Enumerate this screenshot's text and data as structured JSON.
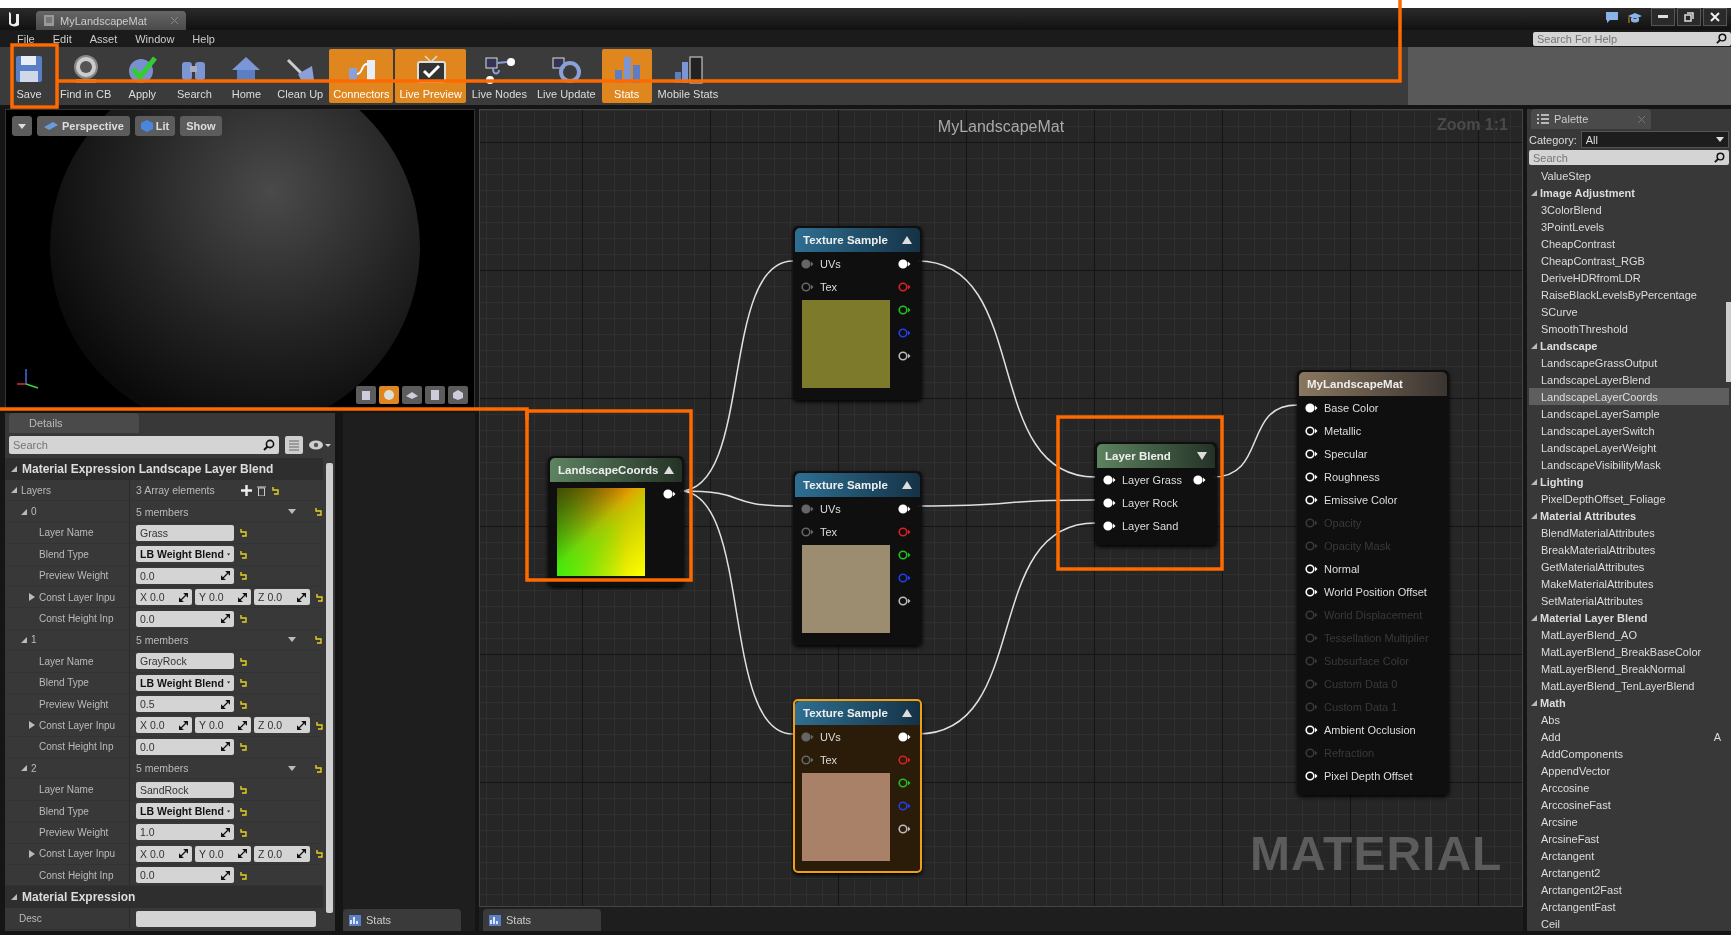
{
  "window": {
    "tab": "MyLandscapeMat"
  },
  "menu": [
    "File",
    "Edit",
    "Asset",
    "Window",
    "Help"
  ],
  "help_search": {
    "placeholder": "Search For Help"
  },
  "toolbar": [
    {
      "label": "Save",
      "kind": "save",
      "on": false
    },
    {
      "label": "Find in CB",
      "kind": "find",
      "on": false
    },
    {
      "label": "Apply",
      "kind": "apply",
      "on": false
    },
    {
      "label": "Search",
      "kind": "search",
      "on": false
    },
    {
      "label": "Home",
      "kind": "home",
      "on": false
    },
    {
      "label": "Clean Up",
      "kind": "cleanup",
      "on": false
    },
    {
      "label": "Connectors",
      "kind": "connectors",
      "on": true
    },
    {
      "label": "Live Preview",
      "kind": "live_preview",
      "on": true
    },
    {
      "label": "Live Nodes",
      "kind": "live_nodes",
      "on": false
    },
    {
      "label": "Live Update",
      "kind": "live_update",
      "on": false
    },
    {
      "label": "Stats",
      "kind": "stats",
      "on": true
    },
    {
      "label": "Mobile Stats",
      "kind": "mobile_stats",
      "on": false
    }
  ],
  "viewport": {
    "view_mode": "Perspective",
    "lighting": "Lit",
    "show": "Show"
  },
  "details": {
    "tab": "Details",
    "search": {
      "placeholder": "Search"
    },
    "sections": [
      {
        "title": "Material Expression Landscape Layer Blend",
        "expanded": true,
        "properties": [
          {
            "kind": "array",
            "label": "Layers",
            "expanded": true,
            "summary": "3 Array elements",
            "elements": [
              {
                "index": "0",
                "expanded": true,
                "summary": "5 members",
                "fields": [
                  {
                    "kind": "text",
                    "label": "Layer Name",
                    "value": "Grass"
                  },
                  {
                    "kind": "dropdown",
                    "label": "Blend Type",
                    "value": "LB Weight Blend"
                  },
                  {
                    "kind": "number",
                    "label": "Preview Weight",
                    "value": "0.0"
                  },
                  {
                    "kind": "vector",
                    "label": "Const Layer Inpu",
                    "expanded": false,
                    "components": [
                      {
                        "axis": "X",
                        "value": "0.0"
                      },
                      {
                        "axis": "Y",
                        "value": "0.0"
                      },
                      {
                        "axis": "Z",
                        "value": "0.0"
                      }
                    ]
                  },
                  {
                    "kind": "number",
                    "label": "Const Height Inp",
                    "value": "0.0"
                  }
                ]
              },
              {
                "index": "1",
                "expanded": true,
                "summary": "5 members",
                "fields": [
                  {
                    "kind": "text",
                    "label": "Layer Name",
                    "value": "GrayRock"
                  },
                  {
                    "kind": "dropdown",
                    "label": "Blend Type",
                    "value": "LB Weight Blend"
                  },
                  {
                    "kind": "number",
                    "label": "Preview Weight",
                    "value": "0.5"
                  },
                  {
                    "kind": "vector",
                    "label": "Const Layer Inpu",
                    "expanded": false,
                    "components": [
                      {
                        "axis": "X",
                        "value": "0.0"
                      },
                      {
                        "axis": "Y",
                        "value": "0.0"
                      },
                      {
                        "axis": "Z",
                        "value": "0.0"
                      }
                    ]
                  },
                  {
                    "kind": "number",
                    "label": "Const Height Inp",
                    "value": "0.0"
                  }
                ]
              },
              {
                "index": "2",
                "expanded": true,
                "summary": "5 members",
                "fields": [
                  {
                    "kind": "text",
                    "label": "Layer Name",
                    "value": "SandRock"
                  },
                  {
                    "kind": "dropdown",
                    "label": "Blend Type",
                    "value": "LB Weight Blend"
                  },
                  {
                    "kind": "number",
                    "label": "Preview Weight",
                    "value": "1.0"
                  },
                  {
                    "kind": "vector",
                    "label": "Const Layer Inpu",
                    "expanded": false,
                    "components": [
                      {
                        "axis": "X",
                        "value": "0.0"
                      },
                      {
                        "axis": "Y",
                        "value": "0.0"
                      },
                      {
                        "axis": "Z",
                        "value": "0.0"
                      }
                    ]
                  },
                  {
                    "kind": "number",
                    "label": "Const Height Inp",
                    "value": "0.0"
                  }
                ]
              }
            ]
          }
        ]
      },
      {
        "title": "Material Expression",
        "expanded": true,
        "properties": [
          {
            "kind": "text",
            "label": "Desc"
          }
        ]
      }
    ]
  },
  "graph": {
    "title": "MyLandscapeMat",
    "zoom": "Zoom 1:1",
    "watermark": "MATERIAL",
    "nodes": [
      {
        "kind": "texture_sample",
        "title": "Texture Sample",
        "selected": false,
        "color": "#7d7a2c",
        "inputs": [
          {
            "label": "UVs",
            "connected": true
          },
          {
            "label": "Tex",
            "connected": false
          }
        ]
      },
      {
        "kind": "texture_sample",
        "title": "Texture Sample",
        "selected": false,
        "color": "#9c8c70",
        "inputs": [
          {
            "label": "UVs",
            "connected": true
          },
          {
            "label": "Tex",
            "connected": false
          }
        ]
      },
      {
        "kind": "texture_sample",
        "title": "Texture Sample",
        "selected": true,
        "color": "#a98068",
        "inputs": [
          {
            "label": "UVs",
            "connected": true
          },
          {
            "label": "Tex",
            "connected": false
          }
        ]
      },
      {
        "kind": "landscape_coords",
        "title": "LandscapeCoords",
        "selected": false
      },
      {
        "kind": "layer_blend",
        "title": "Layer Blend",
        "selected": false,
        "inputs": [
          {
            "label": "Layer Grass",
            "connected": true
          },
          {
            "label": "Layer Rock",
            "connected": true
          },
          {
            "label": "Layer Sand",
            "connected": true
          }
        ]
      },
      {
        "kind": "material_output",
        "title": "MyLandscapeMat",
        "selected": false,
        "inputs": [
          {
            "label": "Base Color",
            "connected": true,
            "disabled": false
          },
          {
            "label": "Metallic",
            "connected": false,
            "disabled": false
          },
          {
            "label": "Specular",
            "connected": false,
            "disabled": false
          },
          {
            "label": "Roughness",
            "connected": false,
            "disabled": false
          },
          {
            "label": "Emissive Color",
            "connected": false,
            "disabled": false
          },
          {
            "label": "Opacity",
            "connected": false,
            "disabled": true
          },
          {
            "label": "Opacity Mask",
            "connected": false,
            "disabled": true
          },
          {
            "label": "Normal",
            "connected": false,
            "disabled": false
          },
          {
            "label": "World Position Offset",
            "connected": false,
            "disabled": false
          },
          {
            "label": "World Displacement",
            "connected": false,
            "disabled": true
          },
          {
            "label": "Tessellation Multiplier",
            "connected": false,
            "disabled": true
          },
          {
            "label": "Subsurface Color",
            "connected": false,
            "disabled": true
          },
          {
            "label": "Custom Data 0",
            "connected": false,
            "disabled": true
          },
          {
            "label": "Custom Data 1",
            "connected": false,
            "disabled": true
          },
          {
            "label": "Ambient Occlusion",
            "connected": false,
            "disabled": false
          },
          {
            "label": "Refraction",
            "connected": false,
            "disabled": true
          },
          {
            "label": "Pixel Depth Offset",
            "connected": false,
            "disabled": false
          }
        ]
      }
    ]
  },
  "bottom_tabs": [
    "Stats",
    "Stats"
  ],
  "palette": {
    "tab": "Palette",
    "category_label": "Category:",
    "category": "All",
    "search": {
      "placeholder": "Search"
    },
    "items": [
      {
        "kind": "item",
        "label": "ValueStep",
        "selected": false
      },
      {
        "kind": "category",
        "label": "Image Adjustment",
        "expanded": true,
        "children": [
          {
            "kind": "item",
            "label": "3ColorBlend",
            "selected": false
          },
          {
            "kind": "item",
            "label": "3PointLevels",
            "selected": false
          },
          {
            "kind": "item",
            "label": "CheapContrast",
            "selected": false
          },
          {
            "kind": "item",
            "label": "CheapContrast_RGB",
            "selected": false
          },
          {
            "kind": "item",
            "label": "DeriveHDRfromLDR",
            "selected": false
          },
          {
            "kind": "item",
            "label": "RaiseBlackLevelsByPercentage",
            "selected": false
          },
          {
            "kind": "item",
            "label": "SCurve",
            "selected": false
          },
          {
            "kind": "item",
            "label": "SmoothThreshold",
            "selected": false
          }
        ]
      },
      {
        "kind": "category",
        "label": "Landscape",
        "expanded": true,
        "children": [
          {
            "kind": "item",
            "label": "LandscapeGrassOutput",
            "selected": false
          },
          {
            "kind": "item",
            "label": "LandscapeLayerBlend",
            "selected": false
          },
          {
            "kind": "item",
            "label": "LandscapeLayerCoords",
            "selected": true
          },
          {
            "kind": "item",
            "label": "LandscapeLayerSample",
            "selected": false
          },
          {
            "kind": "item",
            "label": "LandscapeLayerSwitch",
            "selected": false
          },
          {
            "kind": "item",
            "label": "LandscapeLayerWeight",
            "selected": false
          },
          {
            "kind": "item",
            "label": "LandscapeVisibilityMask",
            "selected": false
          }
        ]
      },
      {
        "kind": "category",
        "label": "Lighting",
        "expanded": true,
        "children": [
          {
            "kind": "item",
            "label": "PixelDepthOffset_Foliage",
            "selected": false
          }
        ]
      },
      {
        "kind": "category",
        "label": "Material Attributes",
        "expanded": true,
        "children": [
          {
            "kind": "item",
            "label": "BlendMaterialAttributes",
            "selected": false
          },
          {
            "kind": "item",
            "label": "BreakMaterialAttributes",
            "selected": false
          },
          {
            "kind": "item",
            "label": "GetMaterialAttributes",
            "selected": false
          },
          {
            "kind": "item",
            "label": "MakeMaterialAttributes",
            "selected": false
          },
          {
            "kind": "item",
            "label": "SetMaterialAttributes",
            "selected": false
          }
        ]
      },
      {
        "kind": "category",
        "label": "Material Layer Blend",
        "expanded": true,
        "children": [
          {
            "kind": "item",
            "label": "MatLayerBlend_AO",
            "selected": false
          },
          {
            "kind": "item",
            "label": "MatLayerBlend_BreakBaseColor",
            "selected": false
          },
          {
            "kind": "item",
            "label": "MatLayerBlend_BreakNormal",
            "selected": false
          },
          {
            "kind": "item",
            "label": "MatLayerBlend_TenLayerBlend",
            "selected": false
          }
        ]
      },
      {
        "kind": "category",
        "label": "Math",
        "expanded": true,
        "children": [
          {
            "kind": "item",
            "label": "Abs",
            "selected": false
          },
          {
            "kind": "item",
            "label": "Add",
            "selected": false,
            "shortcut": "A"
          },
          {
            "kind": "item",
            "label": "AddComponents",
            "selected": false
          },
          {
            "kind": "item",
            "label": "AppendVector",
            "selected": false
          },
          {
            "kind": "item",
            "label": "Arccosine",
            "selected": false
          },
          {
            "kind": "item",
            "label": "ArccosineFast",
            "selected": false
          },
          {
            "kind": "item",
            "label": "Arcsine",
            "selected": false
          },
          {
            "kind": "item",
            "label": "ArcsineFast",
            "selected": false
          },
          {
            "kind": "item",
            "label": "Arctangent",
            "selected": false
          },
          {
            "kind": "item",
            "label": "Arctangent2",
            "selected": false
          },
          {
            "kind": "item",
            "label": "Arctangent2Fast",
            "selected": false
          },
          {
            "kind": "item",
            "label": "ArctangentFast",
            "selected": false
          },
          {
            "kind": "item",
            "label": "Ceil",
            "selected": false
          }
        ]
      }
    ]
  }
}
